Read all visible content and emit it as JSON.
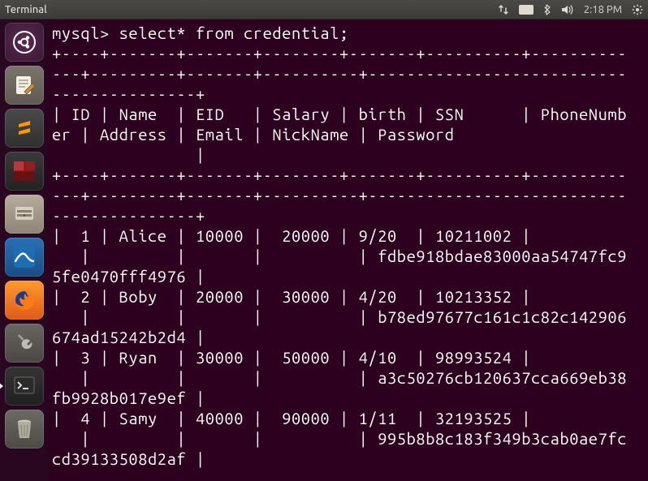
{
  "menubar": {
    "title": "Terminal",
    "language_indicator": "En",
    "clock": "2:18 PM"
  },
  "launcher": {
    "items": [
      {
        "name": "dash",
        "label": "Ubuntu Dash"
      },
      {
        "name": "text-editor",
        "label": "Text Editor"
      },
      {
        "name": "sublime",
        "label": "Sublime Text"
      },
      {
        "name": "terminator",
        "label": "Terminator"
      },
      {
        "name": "files",
        "label": "Files"
      },
      {
        "name": "wireshark",
        "label": "Wireshark"
      },
      {
        "name": "firefox",
        "label": "Firefox"
      },
      {
        "name": "settings",
        "label": "Settings"
      },
      {
        "name": "terminal",
        "label": "Terminal"
      },
      {
        "name": "trash",
        "label": "Trash"
      }
    ]
  },
  "terminal": {
    "prompt": "mysql> ",
    "command": "select* from credential;",
    "columns": [
      "ID",
      "Name",
      "EID",
      "Salary",
      "birth",
      "SSN",
      "PhoneNumber",
      "Address",
      "Email",
      "NickName",
      "Password"
    ],
    "rows": [
      {
        "ID": "1",
        "Name": "Alice",
        "EID": "10000",
        "Salary": "20000",
        "birth": "9/20",
        "SSN": "10211002",
        "PhoneNumber": "",
        "Address": "",
        "Email": "",
        "NickName": "",
        "Password": "fdbe918bdae83000aa54747fc95fe0470fff4976"
      },
      {
        "ID": "2",
        "Name": "Boby",
        "EID": "20000",
        "Salary": "30000",
        "birth": "4/20",
        "SSN": "10213352",
        "PhoneNumber": "",
        "Address": "",
        "Email": "",
        "NickName": "",
        "Password": "b78ed97677c161c1c82c142906674ad15242b2d4"
      },
      {
        "ID": "3",
        "Name": "Ryan",
        "EID": "30000",
        "Salary": "50000",
        "birth": "4/10",
        "SSN": "98993524",
        "PhoneNumber": "",
        "Address": "",
        "Email": "",
        "NickName": "",
        "Password": "a3c50276cb120637cca669eb38fb9928b017e9ef"
      },
      {
        "ID": "4",
        "Name": "Samy",
        "EID": "40000",
        "Salary": "90000",
        "birth": "1/11",
        "SSN": "32193525",
        "PhoneNumber": "",
        "Address": "",
        "Email": "",
        "NickName": "",
        "Password": "995b8b8c183f349b3cab0ae7fccd39133508d2af"
      }
    ],
    "rendered_lines": [
      "mysql> select* from credential;",
      "+----+-------+-------+--------+-------+----------+-------------+---------+-------+----------+------------------------------------------+",
      "| ID | Name  | EID   | Salary | birth | SSN      | PhoneNumber | Address | Email | NickName | Password                                 |",
      "+----+-------+-------+--------+-------+----------+-------------+---------+-------+----------+------------------------------------------+",
      "|  1 | Alice | 10000 |  20000 | 9/20  | 10211002 |             |         |       |          | fdbe918bdae83000aa54747fc95fe0470fff4976 |",
      "|  2 | Boby  | 20000 |  30000 | 4/20  | 10213352 |             |         |       |          | b78ed97677c161c1c82c142906674ad15242b2d4 |",
      "|  3 | Ryan  | 30000 |  50000 | 4/10  | 98993524 |             |         |       |          | a3c50276cb120637cca669eb38fb9928b017e9ef |",
      "|  4 | Samy  | 40000 |  90000 | 1/11  | 32193525 |             |         |       |          | 995b8b8c183f349b3cab0ae7fccd39133508d2af |"
    ],
    "wrap_width": 60
  }
}
